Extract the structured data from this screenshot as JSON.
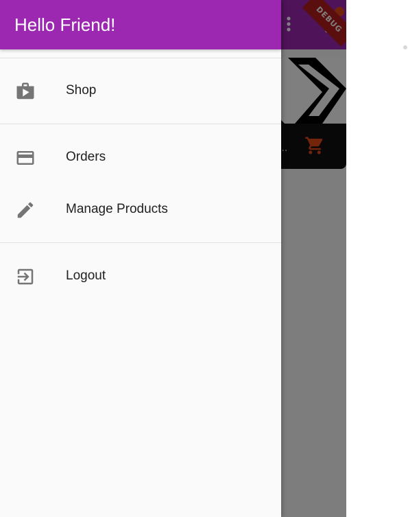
{
  "drawer": {
    "title": "Hello Friend!",
    "items": [
      {
        "label": "Shop",
        "icon": "shop-bag-icon"
      },
      {
        "label": "Orders",
        "icon": "credit-card-icon"
      },
      {
        "label": "Manage Products",
        "icon": "edit-pencil-icon"
      },
      {
        "label": "Logout",
        "icon": "exit-to-app-icon"
      }
    ]
  },
  "background_app": {
    "debug_banner": "DEBUG",
    "icons": [
      "more-vert-icon",
      "shopping-cart-icon"
    ],
    "product_footer_text": "..."
  },
  "colors": {
    "primary": "#9c27b0",
    "accent": "#e64a19",
    "drawer_background": "#fafafa",
    "icon_grey": "#757575"
  }
}
